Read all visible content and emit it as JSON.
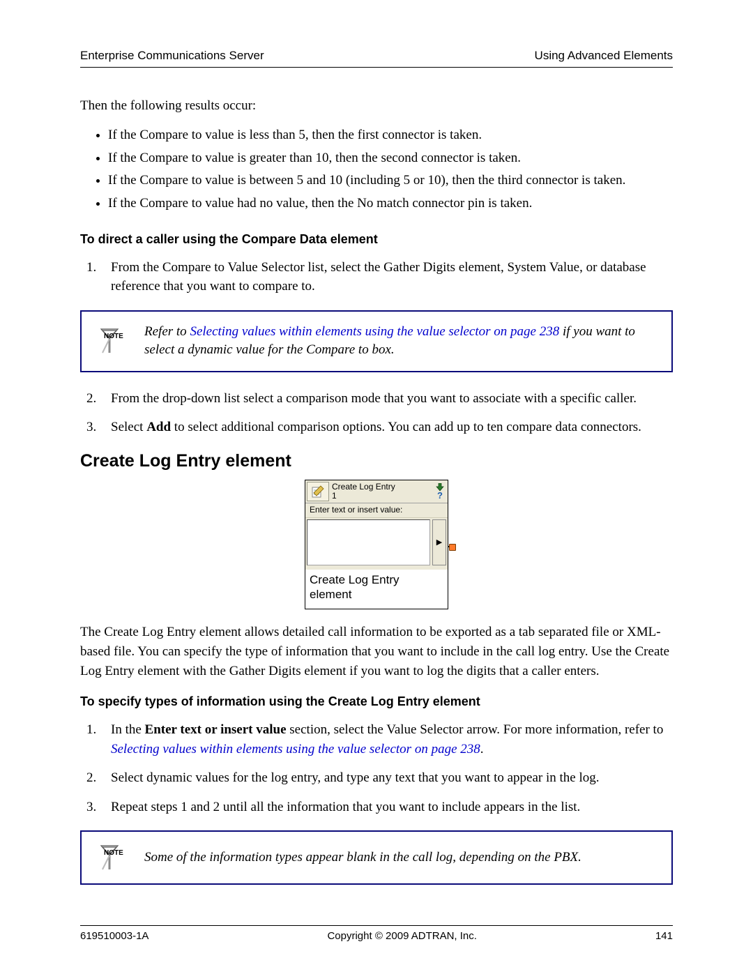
{
  "header": {
    "left": "Enterprise Communications Server",
    "right": "Using Advanced Elements"
  },
  "intro": "Then the following results occur:",
  "bullets": [
    "If the Compare to value is less than 5, then the first connector is taken.",
    "If the Compare to value is greater than 10, then the second connector is taken.",
    "If the Compare to value is between 5 and 10 (including 5 or 10), then the third connector is taken.",
    "If the Compare to value had no value, then the No match connector pin is taken."
  ],
  "sub1": "To direct a caller using the Compare Data element",
  "steps1": {
    "s1": "From the Compare to Value Selector list, select the Gather Digits element, System Value, or database reference that you want to compare to.",
    "s2": "From the drop-down list select a comparison mode that you want to associate with a specific caller.",
    "s3_pre": "Select ",
    "s3_bold": "Add",
    "s3_post": " to select additional comparison options. You can add up to ten compare data connectors."
  },
  "note1": {
    "pre": "Refer to ",
    "link": "Selecting values within elements using the value selector on page 238",
    "post": " if you want to select a dynamic value for the Compare to box."
  },
  "section_heading": "Create Log Entry element",
  "figure": {
    "title1": "Create Log Entry",
    "title2": "1",
    "label": "Enter text or insert value:",
    "triangle": "▶",
    "help": "?",
    "caption": "Create Log Entry element"
  },
  "body_para": "The Create Log Entry element allows detailed call information to be exported as a tab separated file or XML-based file. You can specify the type of information that you want to include in the call log entry. Use the Create Log Entry element with the Gather Digits element if you want to log the digits that a caller enters.",
  "sub2": "To specify types of information using the Create Log Entry element",
  "steps2": {
    "s1_pre": "In the ",
    "s1_bold": "Enter text or insert value",
    "s1_mid": " section, select the Value Selector arrow. For more information, refer to ",
    "s1_link": "Selecting values within elements using the value selector on page 238",
    "s1_post": ".",
    "s2": "Select dynamic values for the log entry, and type any text that you want to appear in the log.",
    "s3": "Repeat steps 1 and 2 until all the information that you want to include appears in the list."
  },
  "note2": "Some of the information types appear blank in the call log, depending on the PBX.",
  "footer": {
    "left": "619510003-1A",
    "center": "Copyright © 2009 ADTRAN, Inc.",
    "right": "141"
  }
}
